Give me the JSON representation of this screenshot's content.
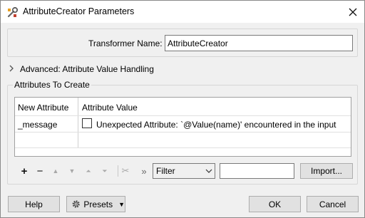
{
  "window": {
    "title": "AttributeCreator Parameters",
    "icon": "transformer-wrench-icon",
    "close_glyph": "✕"
  },
  "transformer_name": {
    "label": "Transformer Name:",
    "value": "AttributeCreator"
  },
  "advanced": {
    "label": "Advanced: Attribute Value Handling",
    "chevron": "›"
  },
  "attributes_group": {
    "title": "Attributes To Create",
    "columns": [
      "New Attribute",
      "Attribute Value"
    ],
    "rows": [
      {
        "name": "_message",
        "value": "Unexpected Attribute: `@Value(name)' encountered in the input"
      }
    ]
  },
  "toolbar": {
    "add": "+",
    "remove": "−",
    "move_up": "▲",
    "move_down": "▼",
    "move_top": "⏶",
    "move_bottom": "⏷",
    "cut": "✂",
    "more": "»",
    "filter_selected": "Filter",
    "filter_text": "",
    "import_label": "Import..."
  },
  "footer": {
    "help_label": "Help",
    "presets_label": "Presets",
    "presets_icon": "gear-icon",
    "ok_label": "OK",
    "cancel_label": "Cancel"
  }
}
